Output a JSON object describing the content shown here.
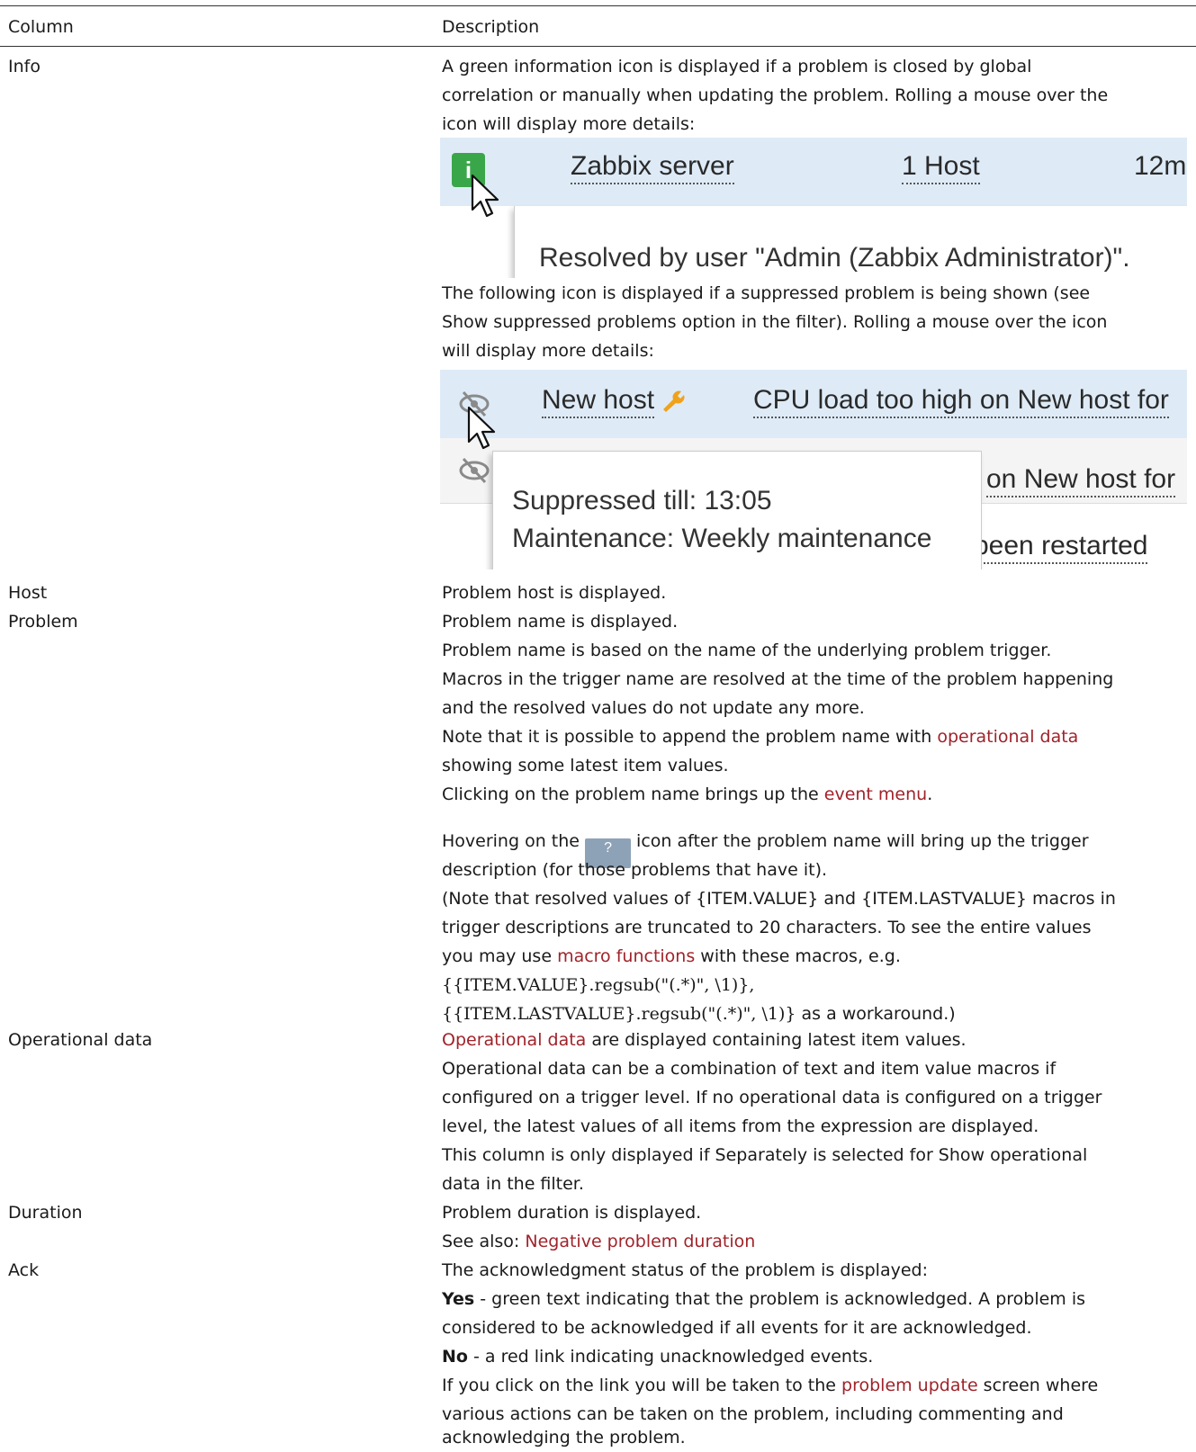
{
  "table": {
    "header": {
      "column": "Column",
      "description": "Description"
    },
    "info": {
      "label": "Info",
      "text_lines": [
        "A green information icon is displayed if a problem is closed by global",
        "correlation or manually when updating the problem. Rolling a mouse over the",
        "icon will display more details:"
      ],
      "shot1": {
        "icon_glyph": "i",
        "host": "Zabbix server",
        "hosts_count": "1 Host",
        "duration": "12m",
        "tooltip": "Resolved by user \"Admin (Zabbix Administrator)\"."
      },
      "text2_lines": [
        "The following icon is displayed if a suppressed problem is being shown (see",
        "Show suppressed problems option in the filter). Rolling a mouse over the icon",
        "will display more details:"
      ],
      "shot2": {
        "host": "New host",
        "problem1": "CPU load too high on New host for",
        "problem2": "on New host for",
        "problem3": "been restarted",
        "tooltip_line1": "Suppressed till: 13:05",
        "tooltip_line2": "Maintenance: Weekly maintenance"
      }
    },
    "host": {
      "label": "Host",
      "text": "Problem host is displayed."
    },
    "problem": {
      "label": "Problem",
      "line1": "Problem name is displayed.",
      "line2": "Problem name is based on the name of the underlying problem trigger.",
      "line3": "Macros in the trigger name are resolved at the time of the problem happening",
      "line4": "and the resolved values do not update any more.",
      "line5_pre": "Note that it is possible to append the problem name with ",
      "line5_link": "operational data",
      "line6": "showing some latest item values.",
      "line7_pre": "Clicking on the problem name brings up the ",
      "line7_link": "event menu",
      "line7_post": ".",
      "line8_pre": "Hovering on the ",
      "help_glyph": "?",
      "line8_post": " icon after the problem name will bring up the trigger",
      "line9": "description (for those problems that have it).",
      "line10": "(Note that resolved values of {ITEM.VALUE} and {ITEM.LASTVALUE} macros in",
      "line11": "trigger descriptions are truncated to 20 characters. To see the entire values",
      "line12_pre": "you may use ",
      "line12_link": "macro functions",
      "line12_post": " with these macros, e.g.",
      "line13": "{{ITEM.VALUE}.regsub(\"(.*)\", \\1)},",
      "line14_code": "{{ITEM.LASTVALUE}.regsub(\"(.*)\", \\1)}",
      "line14_post": " as a workaround.)"
    },
    "operational": {
      "label": "Operational data",
      "line1_link": "Operational data",
      "line1_post": " are displayed containing latest item values.",
      "line2": "Operational data can be a combination of text and item value macros if",
      "line3": "configured on a trigger level. If no operational data is configured on a trigger",
      "line4": "level, the latest values of all items from the expression are displayed.",
      "line5": "This column is only displayed if Separately is selected for Show operational",
      "line6": "data in the filter."
    },
    "duration": {
      "label": "Duration",
      "line1": "Problem duration is displayed.",
      "line2_pre": "See also: ",
      "line2_link": "Negative problem duration"
    },
    "ack": {
      "label": "Ack",
      "line1": "The acknowledgment status of the problem is displayed:",
      "line2_bold": "Yes",
      "line2_post": " - green text indicating that the problem is acknowledged. A problem is",
      "line3": "considered to be acknowledged if all events for it are acknowledged.",
      "line4_bold": "No",
      "line4_post": " - a red link indicating unacknowledged events.",
      "line5_pre": "If you click on the link you will be taken to the ",
      "line5_link": "problem update",
      "line5_post": " screen where",
      "line6": "various actions can be taken on the problem, including commenting and",
      "line7": "acknowledging the problem."
    }
  },
  "colors": {
    "link": "#a0232a",
    "info_icon": "#3aa64a",
    "row_highlight": "#deebf7"
  }
}
